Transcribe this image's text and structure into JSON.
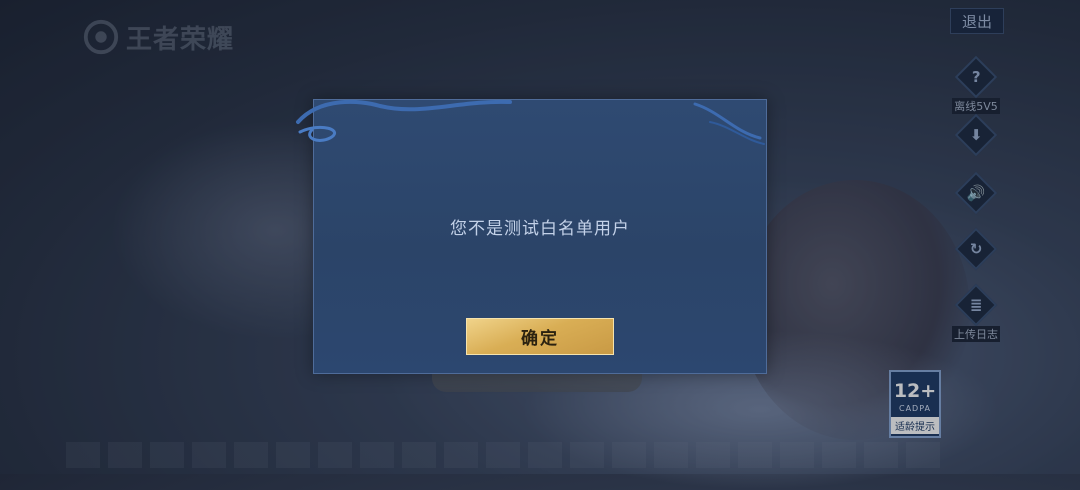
{
  "header": {
    "logo_text": "王者荣耀",
    "exit_label": "退出"
  },
  "sidebar": {
    "items": [
      {
        "icon": "question-icon",
        "glyph": "?",
        "label": "离线5V5"
      },
      {
        "icon": "download-icon",
        "glyph": "⬇",
        "label": ""
      },
      {
        "icon": "speaker-icon",
        "glyph": "🔊",
        "label": ""
      },
      {
        "icon": "refresh-icon",
        "glyph": "↻",
        "label": ""
      },
      {
        "icon": "document-icon",
        "glyph": "≣",
        "label": "上传日志"
      }
    ]
  },
  "age_rating": {
    "age": "12+",
    "org": "CADPA",
    "tip": "适龄提示"
  },
  "dialog": {
    "message": "您不是测试白名单用户",
    "confirm_label": "确定"
  },
  "colors": {
    "dialog_bg": "#2f4a72",
    "confirm_gold": "#d9ae55",
    "accent_blue": "#1f3b66"
  }
}
